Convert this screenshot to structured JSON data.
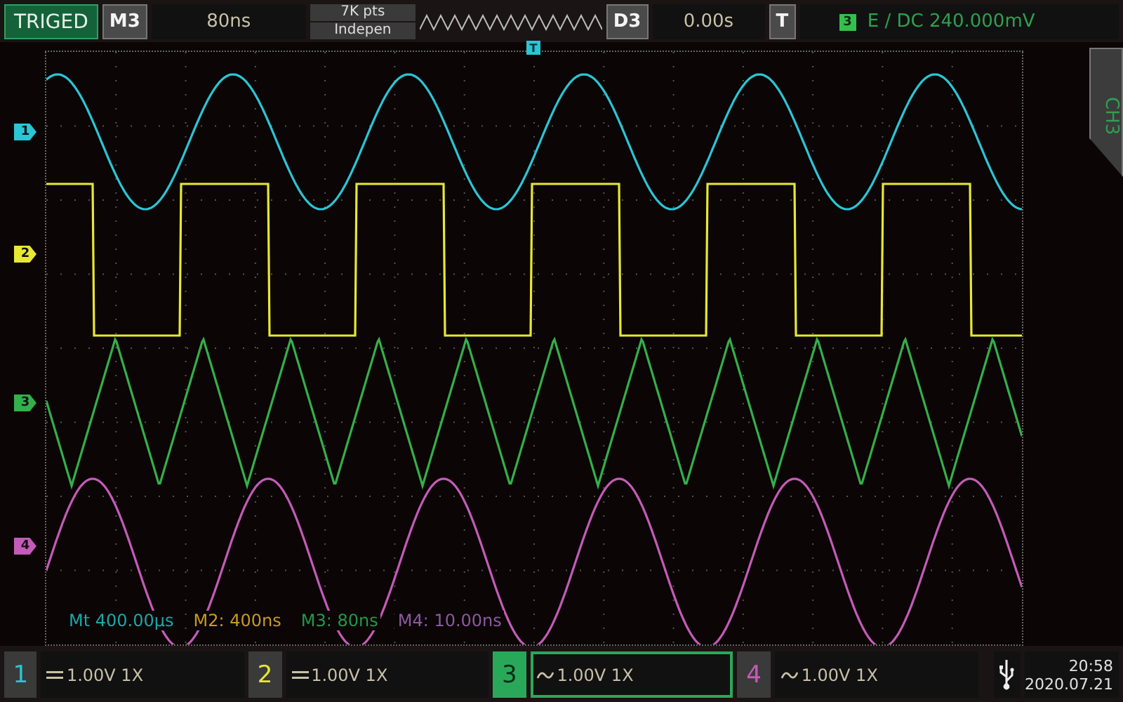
{
  "top_bar": {
    "trigger_status": "TRIGED",
    "math_channel": "M3",
    "timebase": "80ns",
    "memory_depth": "7K pts",
    "memory_mode": "Indepen",
    "delay_channel": "D3",
    "delay": "0.00s",
    "trigger_key": "T",
    "trigger_source": "3",
    "trigger_setting": "E / DC 240.000mV"
  },
  "trigger_marker": "T",
  "side_tab": "CH3",
  "traces": [
    {
      "marker": "1",
      "color": "#29c6d6",
      "kind": "sine"
    },
    {
      "marker": "2",
      "color": "#e8e830",
      "kind": "square"
    },
    {
      "marker": "3",
      "color": "#33b049",
      "kind": "triangle"
    },
    {
      "marker": "4",
      "color": "#c45bb8",
      "kind": "cosine"
    }
  ],
  "measurements": [
    {
      "text": "Mt 400.00μs",
      "color": "#1aa8a8"
    },
    {
      "text": "M2: 400ns",
      "color": "#c89a20"
    },
    {
      "text": "M3: 80ns",
      "color": "#1f9a4a"
    },
    {
      "text": "M4: 10.00ns",
      "color": "#8a5aa0"
    }
  ],
  "channels": [
    {
      "number": "1",
      "kind": "dc",
      "reading": "1.00V 1X",
      "selected": false
    },
    {
      "number": "2",
      "kind": "dc",
      "reading": "1.00V 1X",
      "selected": false
    },
    {
      "number": "3",
      "kind": "ac",
      "reading": "1.00V 1X",
      "selected": true
    },
    {
      "number": "4",
      "kind": "ac",
      "reading": "1.00V 1X",
      "selected": false
    }
  ],
  "status": {
    "time": "20:58",
    "date": "2020.07.21"
  }
}
